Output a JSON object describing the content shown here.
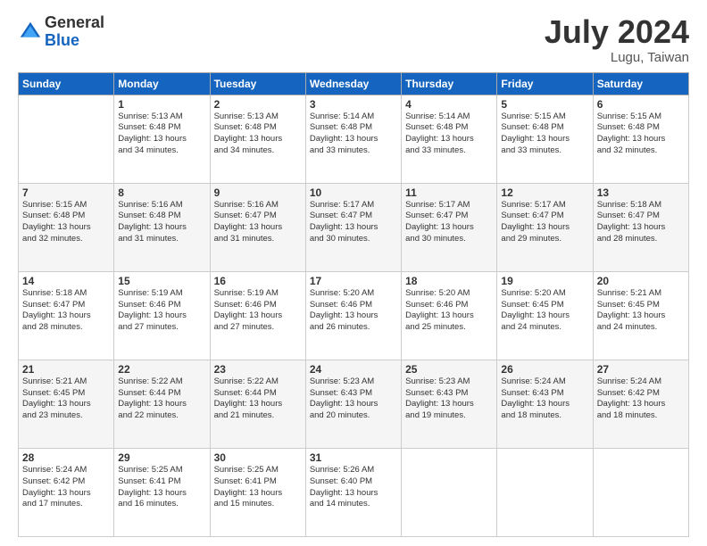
{
  "header": {
    "logo_general": "General",
    "logo_blue": "Blue",
    "month_year": "July 2024",
    "location": "Lugu, Taiwan"
  },
  "weekdays": [
    "Sunday",
    "Monday",
    "Tuesday",
    "Wednesday",
    "Thursday",
    "Friday",
    "Saturday"
  ],
  "weeks": [
    [
      null,
      {
        "day": "1",
        "sunrise": "5:13 AM",
        "sunset": "6:48 PM",
        "daylight": "13 hours and 34 minutes."
      },
      {
        "day": "2",
        "sunrise": "5:13 AM",
        "sunset": "6:48 PM",
        "daylight": "13 hours and 34 minutes."
      },
      {
        "day": "3",
        "sunrise": "5:14 AM",
        "sunset": "6:48 PM",
        "daylight": "13 hours and 33 minutes."
      },
      {
        "day": "4",
        "sunrise": "5:14 AM",
        "sunset": "6:48 PM",
        "daylight": "13 hours and 33 minutes."
      },
      {
        "day": "5",
        "sunrise": "5:15 AM",
        "sunset": "6:48 PM",
        "daylight": "13 hours and 33 minutes."
      },
      {
        "day": "6",
        "sunrise": "5:15 AM",
        "sunset": "6:48 PM",
        "daylight": "13 hours and 32 minutes."
      }
    ],
    [
      {
        "day": "7",
        "sunrise": "5:15 AM",
        "sunset": "6:48 PM",
        "daylight": "13 hours and 32 minutes."
      },
      {
        "day": "8",
        "sunrise": "5:16 AM",
        "sunset": "6:48 PM",
        "daylight": "13 hours and 31 minutes."
      },
      {
        "day": "9",
        "sunrise": "5:16 AM",
        "sunset": "6:47 PM",
        "daylight": "13 hours and 31 minutes."
      },
      {
        "day": "10",
        "sunrise": "5:17 AM",
        "sunset": "6:47 PM",
        "daylight": "13 hours and 30 minutes."
      },
      {
        "day": "11",
        "sunrise": "5:17 AM",
        "sunset": "6:47 PM",
        "daylight": "13 hours and 30 minutes."
      },
      {
        "day": "12",
        "sunrise": "5:17 AM",
        "sunset": "6:47 PM",
        "daylight": "13 hours and 29 minutes."
      },
      {
        "day": "13",
        "sunrise": "5:18 AM",
        "sunset": "6:47 PM",
        "daylight": "13 hours and 28 minutes."
      }
    ],
    [
      {
        "day": "14",
        "sunrise": "5:18 AM",
        "sunset": "6:47 PM",
        "daylight": "13 hours and 28 minutes."
      },
      {
        "day": "15",
        "sunrise": "5:19 AM",
        "sunset": "6:46 PM",
        "daylight": "13 hours and 27 minutes."
      },
      {
        "day": "16",
        "sunrise": "5:19 AM",
        "sunset": "6:46 PM",
        "daylight": "13 hours and 27 minutes."
      },
      {
        "day": "17",
        "sunrise": "5:20 AM",
        "sunset": "6:46 PM",
        "daylight": "13 hours and 26 minutes."
      },
      {
        "day": "18",
        "sunrise": "5:20 AM",
        "sunset": "6:46 PM",
        "daylight": "13 hours and 25 minutes."
      },
      {
        "day": "19",
        "sunrise": "5:20 AM",
        "sunset": "6:45 PM",
        "daylight": "13 hours and 24 minutes."
      },
      {
        "day": "20",
        "sunrise": "5:21 AM",
        "sunset": "6:45 PM",
        "daylight": "13 hours and 24 minutes."
      }
    ],
    [
      {
        "day": "21",
        "sunrise": "5:21 AM",
        "sunset": "6:45 PM",
        "daylight": "13 hours and 23 minutes."
      },
      {
        "day": "22",
        "sunrise": "5:22 AM",
        "sunset": "6:44 PM",
        "daylight": "13 hours and 22 minutes."
      },
      {
        "day": "23",
        "sunrise": "5:22 AM",
        "sunset": "6:44 PM",
        "daylight": "13 hours and 21 minutes."
      },
      {
        "day": "24",
        "sunrise": "5:23 AM",
        "sunset": "6:43 PM",
        "daylight": "13 hours and 20 minutes."
      },
      {
        "day": "25",
        "sunrise": "5:23 AM",
        "sunset": "6:43 PM",
        "daylight": "13 hours and 19 minutes."
      },
      {
        "day": "26",
        "sunrise": "5:24 AM",
        "sunset": "6:43 PM",
        "daylight": "13 hours and 18 minutes."
      },
      {
        "day": "27",
        "sunrise": "5:24 AM",
        "sunset": "6:42 PM",
        "daylight": "13 hours and 18 minutes."
      }
    ],
    [
      {
        "day": "28",
        "sunrise": "5:24 AM",
        "sunset": "6:42 PM",
        "daylight": "13 hours and 17 minutes."
      },
      {
        "day": "29",
        "sunrise": "5:25 AM",
        "sunset": "6:41 PM",
        "daylight": "13 hours and 16 minutes."
      },
      {
        "day": "30",
        "sunrise": "5:25 AM",
        "sunset": "6:41 PM",
        "daylight": "13 hours and 15 minutes."
      },
      {
        "day": "31",
        "sunrise": "5:26 AM",
        "sunset": "6:40 PM",
        "daylight": "13 hours and 14 minutes."
      },
      null,
      null,
      null
    ]
  ]
}
